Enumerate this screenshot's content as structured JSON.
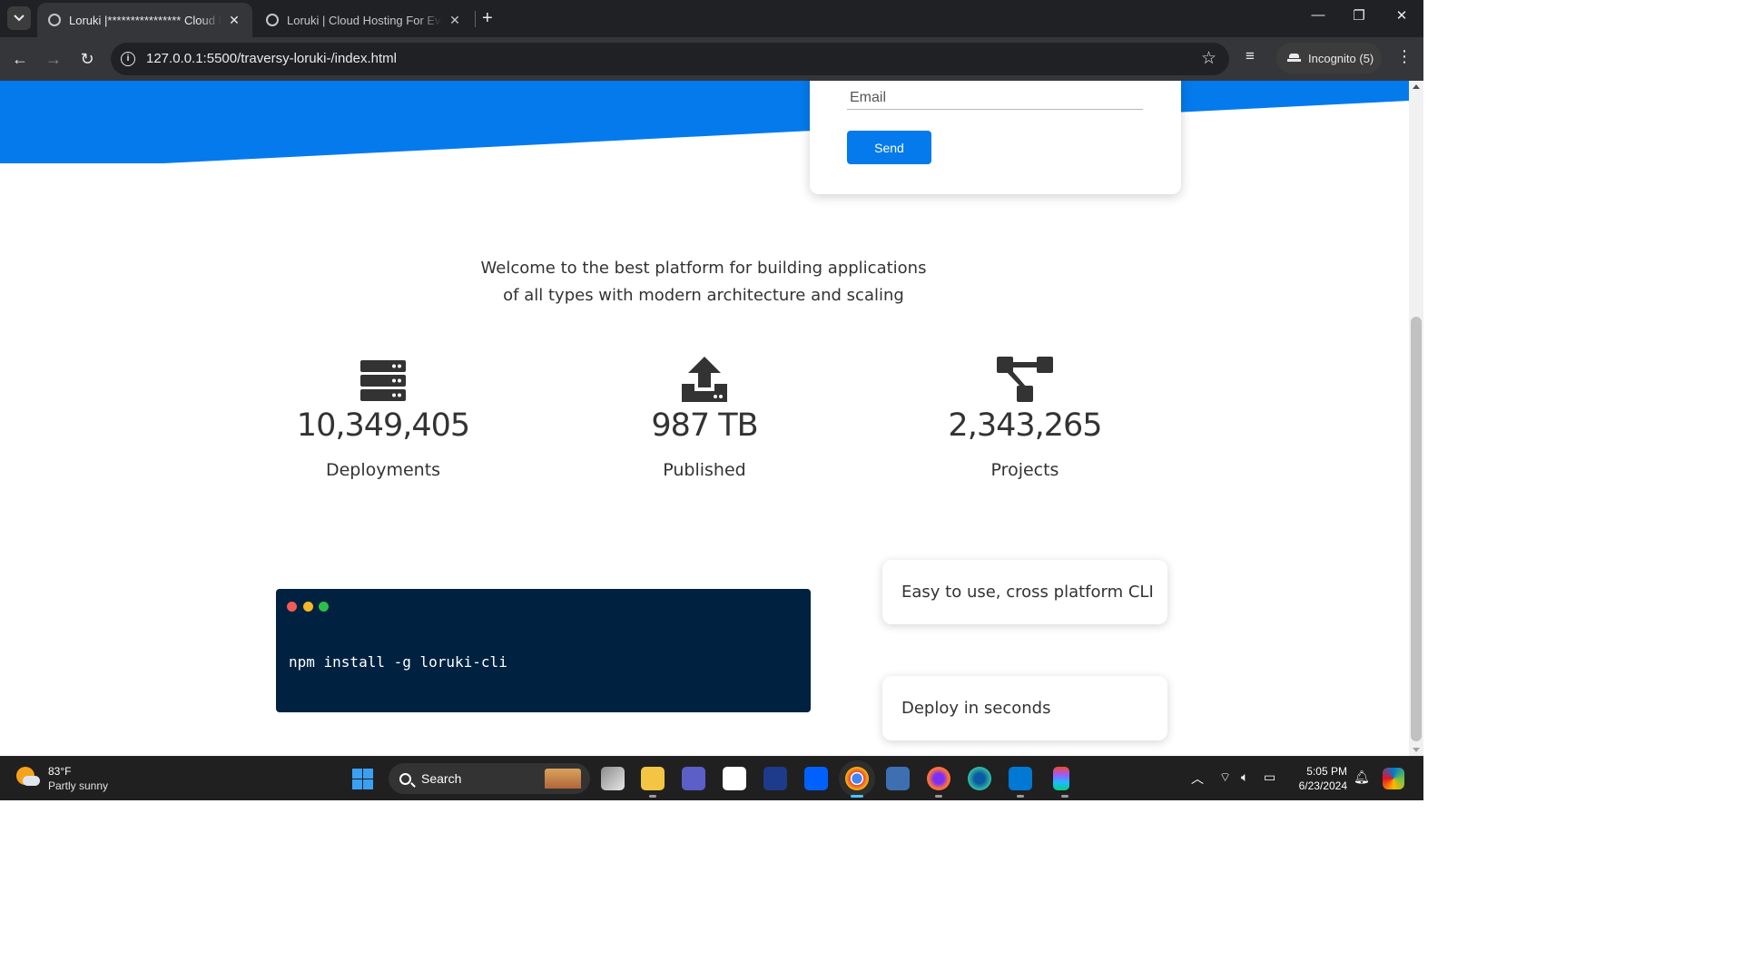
{
  "browser": {
    "tabs": [
      {
        "title": "Loruki |**************** Cloud Hosting For Everyone",
        "active": true
      },
      {
        "title": "Loruki | Cloud Hosting For Everyone",
        "active": false
      }
    ],
    "url": "127.0.0.1:5500/traversy-loruki-/index.html",
    "incognito_label": "Incognito (5)"
  },
  "page": {
    "form": {
      "email_placeholder": "Email",
      "send_label": "Send"
    },
    "welcome_text": "Welcome to the best platform for building applications of all types with modern architecture and scaling",
    "stats": [
      {
        "icon": "server-icon",
        "value": "10,349,405",
        "label": "Deployments"
      },
      {
        "icon": "upload-icon",
        "value": "987 TB",
        "label": "Published"
      },
      {
        "icon": "project-diagram-icon",
        "value": "2,343,265",
        "label": "Projects"
      }
    ],
    "terminal": {
      "command": "npm install -g loruki-cli"
    },
    "features": [
      "Easy to use, cross platform CLI",
      "Deploy in seconds"
    ],
    "colors": {
      "primary": "#047aed",
      "terminal_bg": "#002240",
      "text": "#333333"
    }
  },
  "taskbar": {
    "weather": {
      "temp": "83°F",
      "condition": "Partly sunny"
    },
    "search_label": "Search",
    "time": "5:05 PM",
    "date": "6/23/2024"
  }
}
